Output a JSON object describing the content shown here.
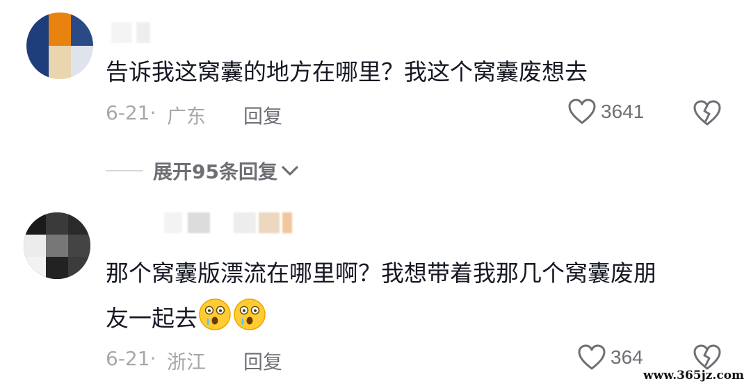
{
  "comments": [
    {
      "text": "告诉我这窝囊的地方在哪里？我这个窝囊废想去",
      "date": "6-21·",
      "region": "广东",
      "reply_label": "回复",
      "likes": "3641"
    },
    {
      "text_line1": "那个窝囊版漂流在哪里啊？我想带着我那几个窝囊废朋",
      "text_line2": "友一起去",
      "date": "6-21·",
      "region": "浙江",
      "reply_label": "回复",
      "likes": "364",
      "emoji": [
        "astonished-face-emoji",
        "astonished-face-emoji"
      ]
    }
  ],
  "expand_replies": {
    "label": "展开95条回复"
  },
  "watermark": "www.365jz.com",
  "colors": {
    "text": "#161823",
    "meta": "#a6a7ab",
    "action": "#6e6f75"
  }
}
